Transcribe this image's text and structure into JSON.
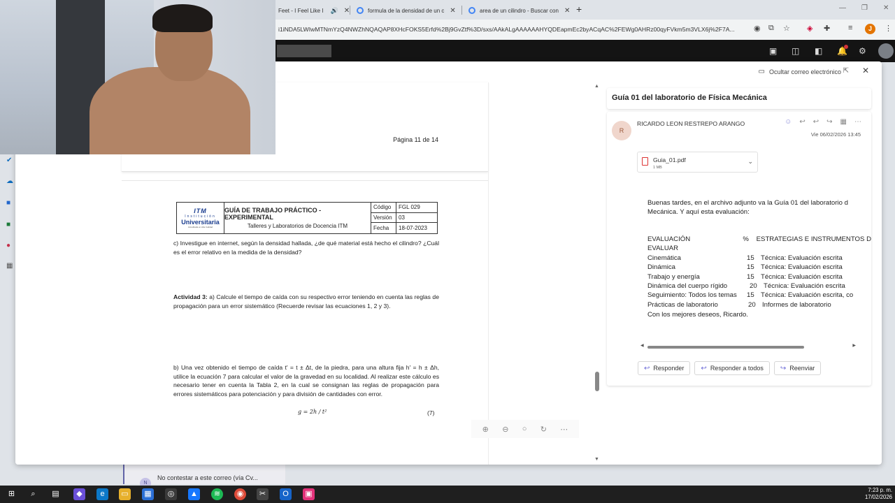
{
  "browser": {
    "tabs": [
      {
        "title": "Feet - I Feel Like I"
      },
      {
        "title": "formula de la densidad de un c"
      },
      {
        "title": "area de un cilindro - Buscar con"
      }
    ],
    "url": "i1iNDA5LWIwMTNmYzQ4NWZhNQAQAP8XHcFOKS5Erfd%2Bj9GvZtf%3D/sxs/AAkALgAAAAAAHYQDEapmEc2byACqAC%2FEWg0AHRz00qyFVkm5m3VLX6j%2F7A...",
    "profile_initial": "J"
  },
  "outlook": {
    "hide_email_label": "Ocultar correo electrónico",
    "avatar_initials": ""
  },
  "pdf": {
    "page_label": "Página 11 de 14",
    "header": {
      "logo_mark": "ITM",
      "logo_inst": "Institución",
      "logo_uni": "Universitaria",
      "logo_sub": "Acreditada en Alta Calidad",
      "title": "GUÍA DE TRABAJO PRÁCTICO - EXPERIMENTAL",
      "subtitle": "Talleres y Laboratorios de Docencia ITM",
      "codigo_label": "Código",
      "codigo_value": "FGL 029",
      "version_label": "Versión",
      "version_value": "03",
      "fecha_label": "Fecha",
      "fecha_value": "18-07-2023"
    },
    "para_c": "c) Investigue en internet, según la densidad hallada, ¿de qué material está hecho el cilindro? ¿Cuál es el error relativo en la medida de la densidad?",
    "act3_bold": "Actividad 3:",
    "act3_text": " a) Calcule el tiempo de caída con su respectivo error teniendo en cuenta las reglas de propagación para un error sistemático (Recuerde revisar las ecuaciones 1, 2 y 3).",
    "para_b": "b) Una vez obtenido el tiempo de caída t' = t ± Δt, de la piedra, para una altura fija h' = h ± Δh, utilice la ecuación 7 para calcular el valor de la gravedad en su localidad. Al realizar este cálculo es necesario tener en cuenta la Tabla 2, en la cual se consignan las reglas de propagación para errores sistemáticos para potenciación y para división de cantidades con error.",
    "formula": "g = 2h / t²",
    "eq_number": "(7)"
  },
  "email": {
    "subject": "Guía 01 del laboratorio de Física Mecánica",
    "sender_initial": "R",
    "sender": "RICARDO LEON RESTREPO ARANGO",
    "date": "Vie 06/02/2026 13:45",
    "attachment_name": "Guia_01.pdf",
    "attachment_size": "1 MB",
    "body_line1": "Buenas tardes, en el archivo adjunto va la Guía 01 del laboratorio d",
    "body_line2": "Mecánica. Y aquí esta evaluación:",
    "eval_header": {
      "c1": "EVALUACIÓN",
      "c2": "%",
      "c3": "ESTRATEGIAS E INSTRUMENTOS D"
    },
    "eval_header2": "EVALUAR",
    "eval_rows": [
      {
        "c1": "Cinemática",
        "c2": "15",
        "c3": "Técnica: Evaluación escrita"
      },
      {
        "c1": "Dinámica",
        "c2": "15",
        "c3": "Técnica: Evaluación escrita"
      },
      {
        "c1": "Trabajo y energía",
        "c2": "15",
        "c3": "Técnica: Evaluación escrita"
      },
      {
        "c1": "Dinámica del cuerpo rígido",
        "c2": "20",
        "c3": "Técnica: Evaluación escrita"
      },
      {
        "c1": "Seguimiento: Todos los temas",
        "c2": "15",
        "c3": "Técnica: Evaluación escrita, co"
      },
      {
        "c1": "Prácticas de laboratorio",
        "c2": "20",
        "c3": "Informes de laboratorio"
      }
    ],
    "closing": "Con los mejores deseos,  Ricardo.",
    "reply_label": "Responder",
    "reply_all_label": "Responder a todos",
    "forward_label": "Reenviar"
  },
  "draft": {
    "initial": "N",
    "text": "No contestar a este correo (vía Cv..."
  },
  "taskbar": {
    "time": "7:23 p. m.",
    "date": "17/02/2026"
  }
}
